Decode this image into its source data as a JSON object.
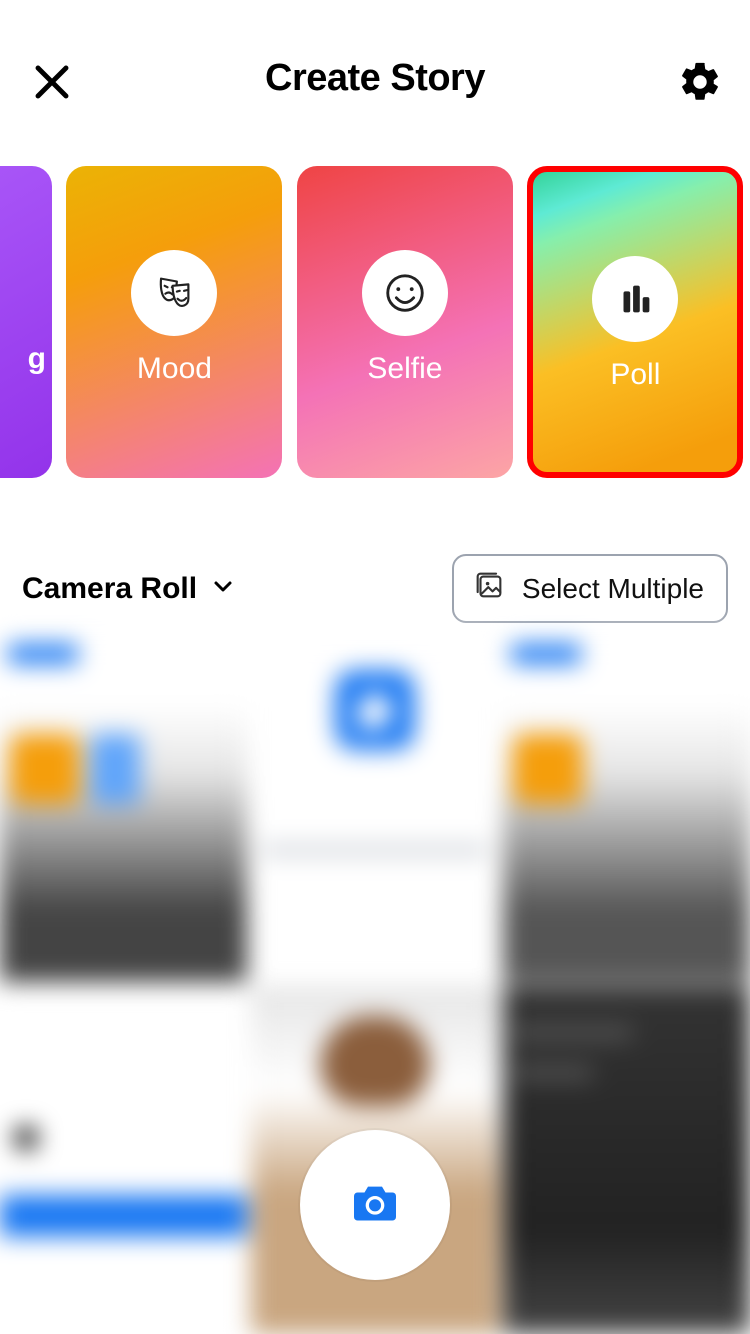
{
  "header": {
    "title": "Create Story"
  },
  "story_cards": {
    "partial_visible_text": "g",
    "items": [
      {
        "label": "Mood",
        "icon": "masks-icon"
      },
      {
        "label": "Selfie",
        "icon": "smiley-icon"
      },
      {
        "label": "Poll",
        "icon": "poll-bars-icon",
        "highlighted": true
      }
    ]
  },
  "source": {
    "selected": "Camera Roll",
    "multi_button_label": "Select Multiple"
  },
  "colors": {
    "highlight_border": "#ff0000",
    "facebook_blue": "#1877f2"
  }
}
